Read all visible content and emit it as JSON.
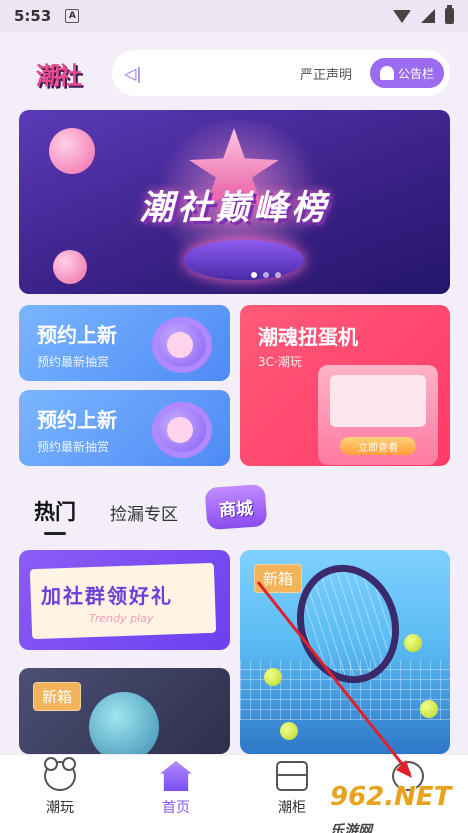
{
  "status": {
    "time": "5:53",
    "app_badge": "A"
  },
  "header": {
    "logo_text": "潮社",
    "notice_text": "严正声明",
    "notice_button": "公告栏"
  },
  "banner": {
    "title": "潮社巅峰榜"
  },
  "cards": {
    "preorder1": {
      "title": "预约上新",
      "sub": "预约最新抽赏"
    },
    "preorder2": {
      "title": "预约上新",
      "sub": "预约最新抽赏"
    },
    "gacha": {
      "title": "潮魂扭蛋机",
      "sub": "3C·潮玩",
      "btn": "立即查看"
    }
  },
  "tabs": {
    "hot": "热门",
    "leak": "捡漏专区",
    "mall": "商城"
  },
  "grid": {
    "promo_title": "加社群领好礼",
    "promo_sub": "Trendy play",
    "tag_new1": "新箱",
    "tag_new2": "新箱"
  },
  "nav": {
    "toys": "潮玩",
    "home": "首页",
    "cabinet": "潮柜",
    "me": ""
  },
  "watermark": {
    "main": "962",
    "suffix": ".NET",
    "sub": "乐游网"
  },
  "colors": {
    "accent": "#8a56f0",
    "pink": "#ff3a66",
    "blue": "#4e8af5"
  }
}
